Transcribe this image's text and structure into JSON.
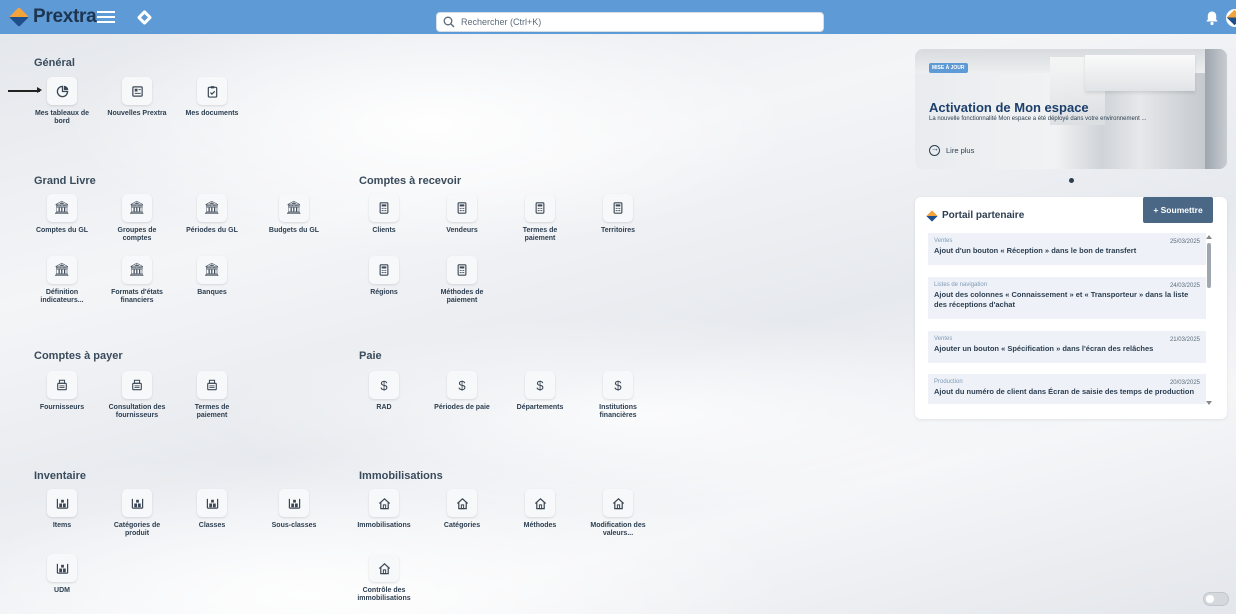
{
  "app": {
    "brand": "Prextra"
  },
  "search": {
    "placeholder": "Rechercher (Ctrl+K)"
  },
  "sections": {
    "general": {
      "title": "Général",
      "items": [
        "Mes tableaux de bord",
        "Nouvelles Prextra",
        "Mes documents"
      ]
    },
    "grand_livre": {
      "title": "Grand Livre",
      "items": [
        "Comptes du GL",
        "Groupes de comptes",
        "Périodes du GL",
        "Budgets du GL",
        "Définition indicateurs...",
        "Formats d'états financiers",
        "Banques"
      ]
    },
    "comptes_recevoir": {
      "title": "Comptes à recevoir",
      "items": [
        "Clients",
        "Vendeurs",
        "Termes de paiement",
        "Territoires",
        "Régions",
        "Méthodes de paiement"
      ]
    },
    "comptes_payer": {
      "title": "Comptes à payer",
      "items": [
        "Fournisseurs",
        "Consultation des fournisseurs",
        "Termes de paiement"
      ]
    },
    "paie": {
      "title": "Paie",
      "items": [
        "RAD",
        "Périodes de paie",
        "Départements",
        "Institutions financières"
      ]
    },
    "inventaire": {
      "title": "Inventaire",
      "items": [
        "Items",
        "Catégories de produit",
        "Classes",
        "Sous-classes",
        "UDM"
      ]
    },
    "immobilisations": {
      "title": "Immobilisations",
      "items": [
        "Immobilisations",
        "Catégories",
        "Méthodes",
        "Modification des valeurs...",
        "Contrôle des immobilisations"
      ]
    }
  },
  "banner": {
    "badge": "MISE À JOUR",
    "title": "Activation de Mon espace",
    "description": "La nouvelle fonctionnalité Mon espace a été déployé dans votre environnement ...",
    "link": "Lire plus"
  },
  "portal": {
    "title": "Portail partenaire",
    "submit_label": "+ Soumettre",
    "news": [
      {
        "category": "Ventes",
        "date": "25/03/2025",
        "text": "Ajout d'un bouton « Réception » dans le bon de transfert"
      },
      {
        "category": "Listes de navigation",
        "date": "24/03/2025",
        "text": "Ajout des colonnes « Connaissement » et « Transporteur » dans la liste des réceptions d'achat"
      },
      {
        "category": "Ventes",
        "date": "21/03/2025",
        "text": "Ajouter un bouton « Spécification » dans l'écran des relâches"
      },
      {
        "category": "Production",
        "date": "20/03/2025",
        "text": "Ajout du numéro de client dans Écran de saisie des temps de production"
      }
    ]
  }
}
